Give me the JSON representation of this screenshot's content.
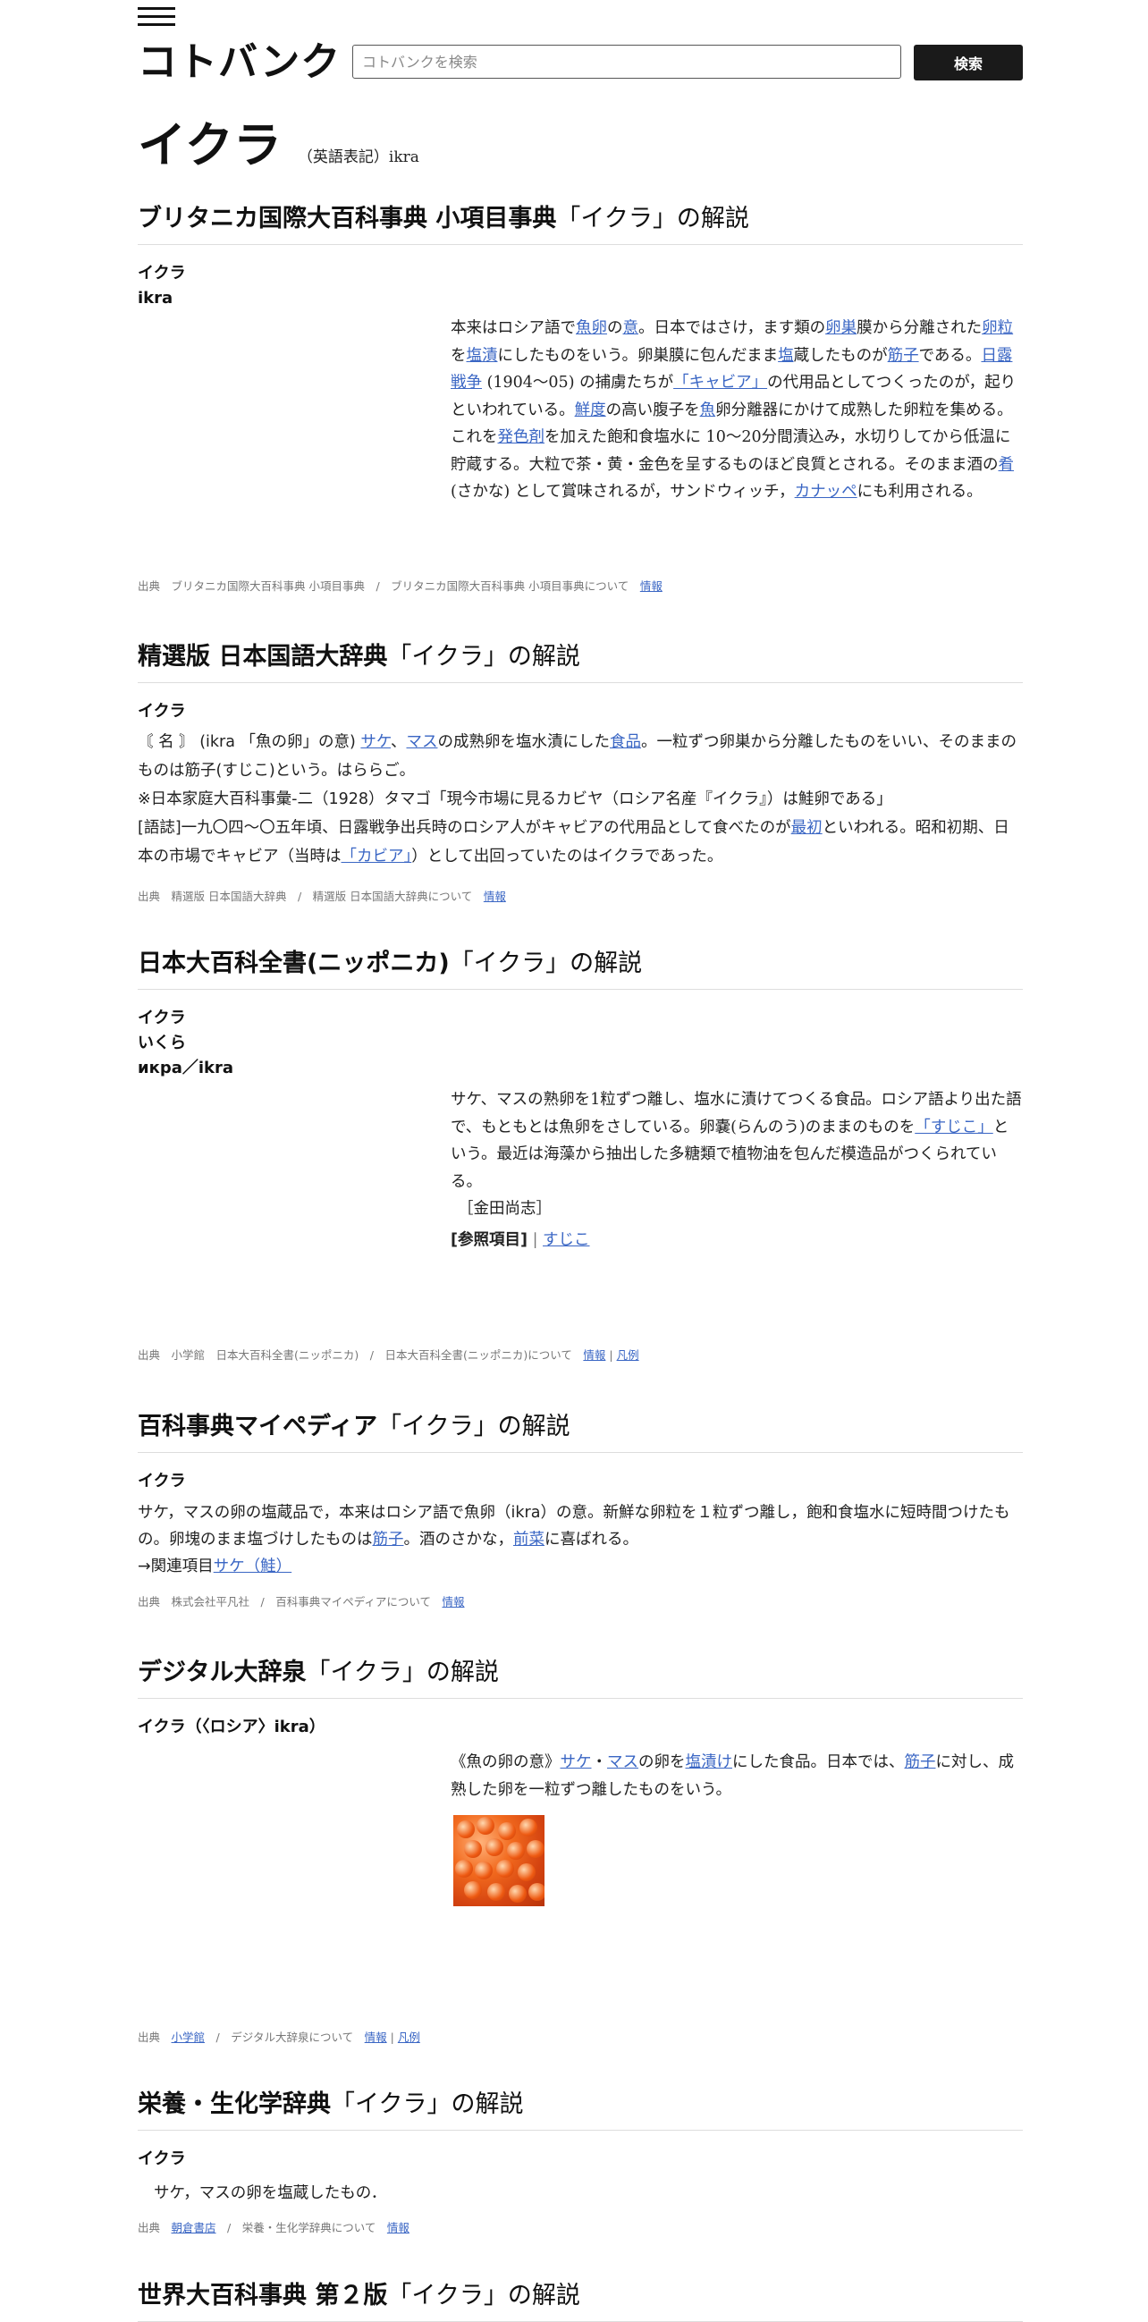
{
  "header": {
    "logo": "コトバンク",
    "search_placeholder": "コトバンクを検索",
    "search_button": "検索"
  },
  "page": {
    "title": "イクラ",
    "title_en": "（英語表記）ikra"
  },
  "sections": {
    "britannica": {
      "heading_bold": "ブリタニカ国際大百科事典 小項目事典",
      "heading_rest": "「イクラ」の解説",
      "term1": "イクラ",
      "term2": "ikra",
      "source": "出典　ブリタニカ国際大百科事典 小項目事典　/　ブリタニカ国際大百科事典 小項目事典について",
      "info_link": "情報"
    },
    "seisen": {
      "heading_bold": "精選版 日本国語大辞典",
      "heading_rest": "「イクラ」の解説",
      "term": "イクラ",
      "line3": "※日本家庭大百科事彙-二（1928）タマゴ「現今市場に見るカビヤ（ロシア名産『イクラ』）は鮭卵である」",
      "source": "出典　精選版 日本国語大辞典　/　精選版 日本国語大辞典について",
      "info_link": "情報"
    },
    "nipponica": {
      "heading_bold": "日本大百科全書(ニッポニカ)",
      "heading_rest": "「イクラ」の解説",
      "term1": "イクラ",
      "term2": "いくら",
      "term3": "икра／ikra",
      "author": "［金田尚志］",
      "ref_label": "[参照項目]",
      "ref_sep": " | ",
      "ref_link": "すじこ",
      "source": "出典　小学館　日本大百科全書(ニッポニカ)　/　日本大百科全書(ニッポニカ)について",
      "info_link": "情報",
      "sep": " | ",
      "hanrei_link": "凡例"
    },
    "mypedia": {
      "heading_bold": "百科事典マイペディア",
      "heading_rest": "「イクラ」の解説",
      "term": "イクラ",
      "related_prefix": "→関連項目",
      "related_link": "サケ（鮭）",
      "source": "出典　株式会社平凡社　/　百科事典マイペディアについて",
      "info_link": "情報"
    },
    "daijisen": {
      "heading_bold": "デジタル大辞泉",
      "heading_rest": "「イクラ」の解説",
      "term": "イクラ（〈ロシア〉ikra）",
      "image_alt": "イクラの写真",
      "source_prefix": "出典　",
      "publisher_link": "小学館",
      "source_rest": "　/　デジタル大辞泉について",
      "info_link": "情報",
      "sep": " | ",
      "hanrei_link": "凡例"
    },
    "eiyo": {
      "heading_bold": "栄養・生化学辞典",
      "heading_rest": "「イクラ」の解説",
      "term": "イクラ",
      "text": "サケ，マスの卵を塩蔵したもの．",
      "source_prefix": "出典　",
      "publisher_link": "朝倉書店",
      "source_rest": "　/　栄養・生化学辞典について",
      "info_link": "情報"
    },
    "sekai": {
      "heading_bold": "世界大百科事典 第２版",
      "heading_rest": "「イクラ」の解説"
    }
  }
}
